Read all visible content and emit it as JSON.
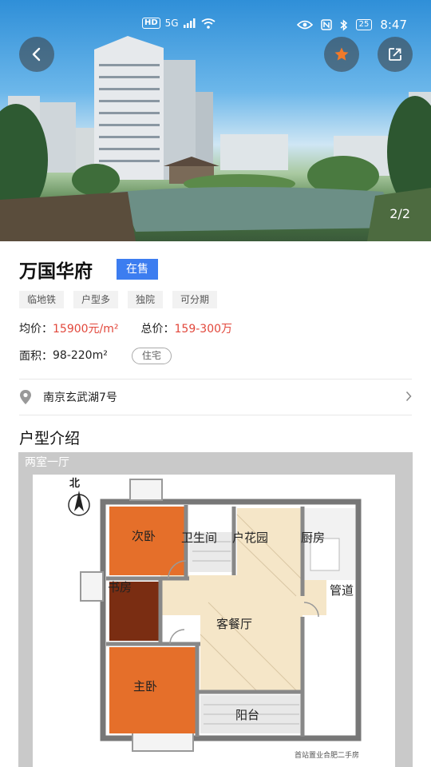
{
  "status": {
    "hd": "HD",
    "signal": "5G",
    "battery": "25",
    "time": "8:47"
  },
  "gallery": {
    "indicator": "2/2"
  },
  "property": {
    "name": "万国华府",
    "status_badge": "在售",
    "tags": [
      "临地铁",
      "户型多",
      "独院",
      "可分期"
    ],
    "avg_price_label": "均价：",
    "avg_price_value": "15900元/m²",
    "total_price_label": "总价：",
    "total_price_value": "159-300万",
    "area_label": "面积：",
    "area_value": "98-220m²",
    "type_tag": "住宅",
    "address": "南京玄武湖7号"
  },
  "floorplan": {
    "section_title": "户型介绍",
    "plan_name": "两室一厅",
    "compass": "北",
    "rooms": {
      "second_bedroom": "次卧",
      "bathroom": "卫生间",
      "garden": "户花园",
      "kitchen": "厨房",
      "study": "书房",
      "corridor": "管道",
      "living_dining": "客餐厅",
      "master_bedroom": "主卧",
      "balcony": "阳台"
    },
    "watermark": "首站置业合肥二手房"
  },
  "colors": {
    "accent": "#3c7df0",
    "price_red": "#e2473b",
    "fav_star": "#f07a2a"
  }
}
